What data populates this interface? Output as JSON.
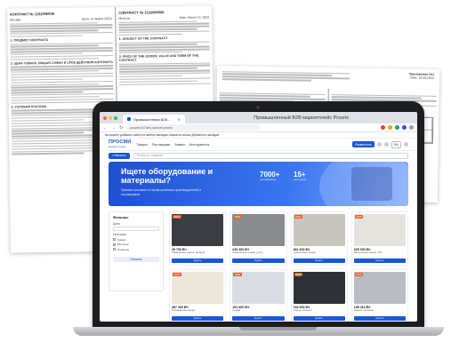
{
  "doc_left": {
    "col1_title": "КОНТРАКТ № 1122/09/006",
    "col1_city": "Москва",
    "col1_date": "Дата: 14 марта 2022г",
    "col1_sections": [
      "1. ПРЕДМЕТ КОНТРАКТА",
      "2. ЦЕНА ТОВАРА, ОБЩАЯ СУММА И СРОК ДЕЙСТВИЯ КОНТРАКТА",
      "3. УСЛОВИЯ ПЛАТЕЖА"
    ],
    "col2_title": "CONTRACT № 1122/09/006",
    "col2_city": "Moscow",
    "col2_date": "Date: March 14, 2022",
    "col2_sections": [
      "1. SUBJECT OF THE CONTRACT",
      "2. PRICE OF THE GOODS, VALUE AND TERM OF THE CONTRACT"
    ]
  },
  "doc_right": {
    "title": "Приложение №1",
    "date": "Date: 14.03.2022",
    "table_heading_1": "Commodity and specification",
    "table_heading_2": "Товар и спецификация"
  },
  "browser": {
    "tab_label": "Промышленная B2B...",
    "window_title": "Промышленный B2B маркетплейс Prosmi",
    "url": "prosmi.ru/?utm_source=promo",
    "bookmarks": "Вы можете добавить сайты на панель закладок, нажав на значок Добавить в закладки"
  },
  "site": {
    "logo": "ПРОСМИ",
    "logo_sub": "маркетплейс",
    "menu": [
      "Товары",
      "Поставщики",
      "Заявки",
      "Инструменты"
    ],
    "post_button": "Разместить",
    "lang": "RU",
    "catalog_button": "≡ Каталог",
    "search_placeholder": "Поиск по товарам",
    "hero_title": "Ищете оборудование и материалы?",
    "hero_sub": "Прямые поставки от промышленных производителей и поставщиков",
    "stat1_value": "7000+",
    "stat1_label": "поставщиков",
    "stat2_value": "15+",
    "stat2_label": "категорий",
    "filters_title": "Фильтры",
    "filter_label_price": "Цена",
    "filter_label_category": "Категория",
    "filter_options": [
      "Химия",
      "Металлы",
      "Пластики"
    ],
    "filter_button": "Показать",
    "products": [
      {
        "price": "39 700 ₽/т",
        "name": "Химическое сырьё, пигмент",
        "badge": "NEW",
        "color": "#3b3d42",
        "buy": "Купить"
      },
      {
        "price": "246 400 ₽/т",
        "name": "Химическое сырьё, уголь",
        "badge": "NEW",
        "color": "#8a8c90",
        "buy": "Купить"
      },
      {
        "price": "281 600 ₽/т",
        "name": "Химическое сырьё",
        "badge": "NEW",
        "color": "#c9c6bf",
        "buy": "Купить"
      },
      {
        "price": "325 000 ₽/т",
        "name": "Химическое сырьё, ТМ",
        "badge": "NEW",
        "color": "#e5e3dd",
        "buy": "Купить"
      },
      {
        "price": "487 200 ₽/т",
        "name": "Полимерное сырьё",
        "badge": "NEW",
        "color": "#ece7d8",
        "buy": "Купить"
      },
      {
        "price": "191 900 ₽/т",
        "name": "Сырьё",
        "badge": "NEW",
        "color": "#d9dde3",
        "buy": "Купить"
      },
      {
        "price": "218 000 ₽/т",
        "name": "Сырьё, пигмент",
        "badge": "NEW",
        "color": "#2f3136",
        "buy": "Купить"
      },
      {
        "price": "195 412 ₽/т",
        "name": "Сырьё, порошок",
        "badge": "NEW",
        "color": "#b9bcc2",
        "buy": "Купить"
      }
    ]
  }
}
